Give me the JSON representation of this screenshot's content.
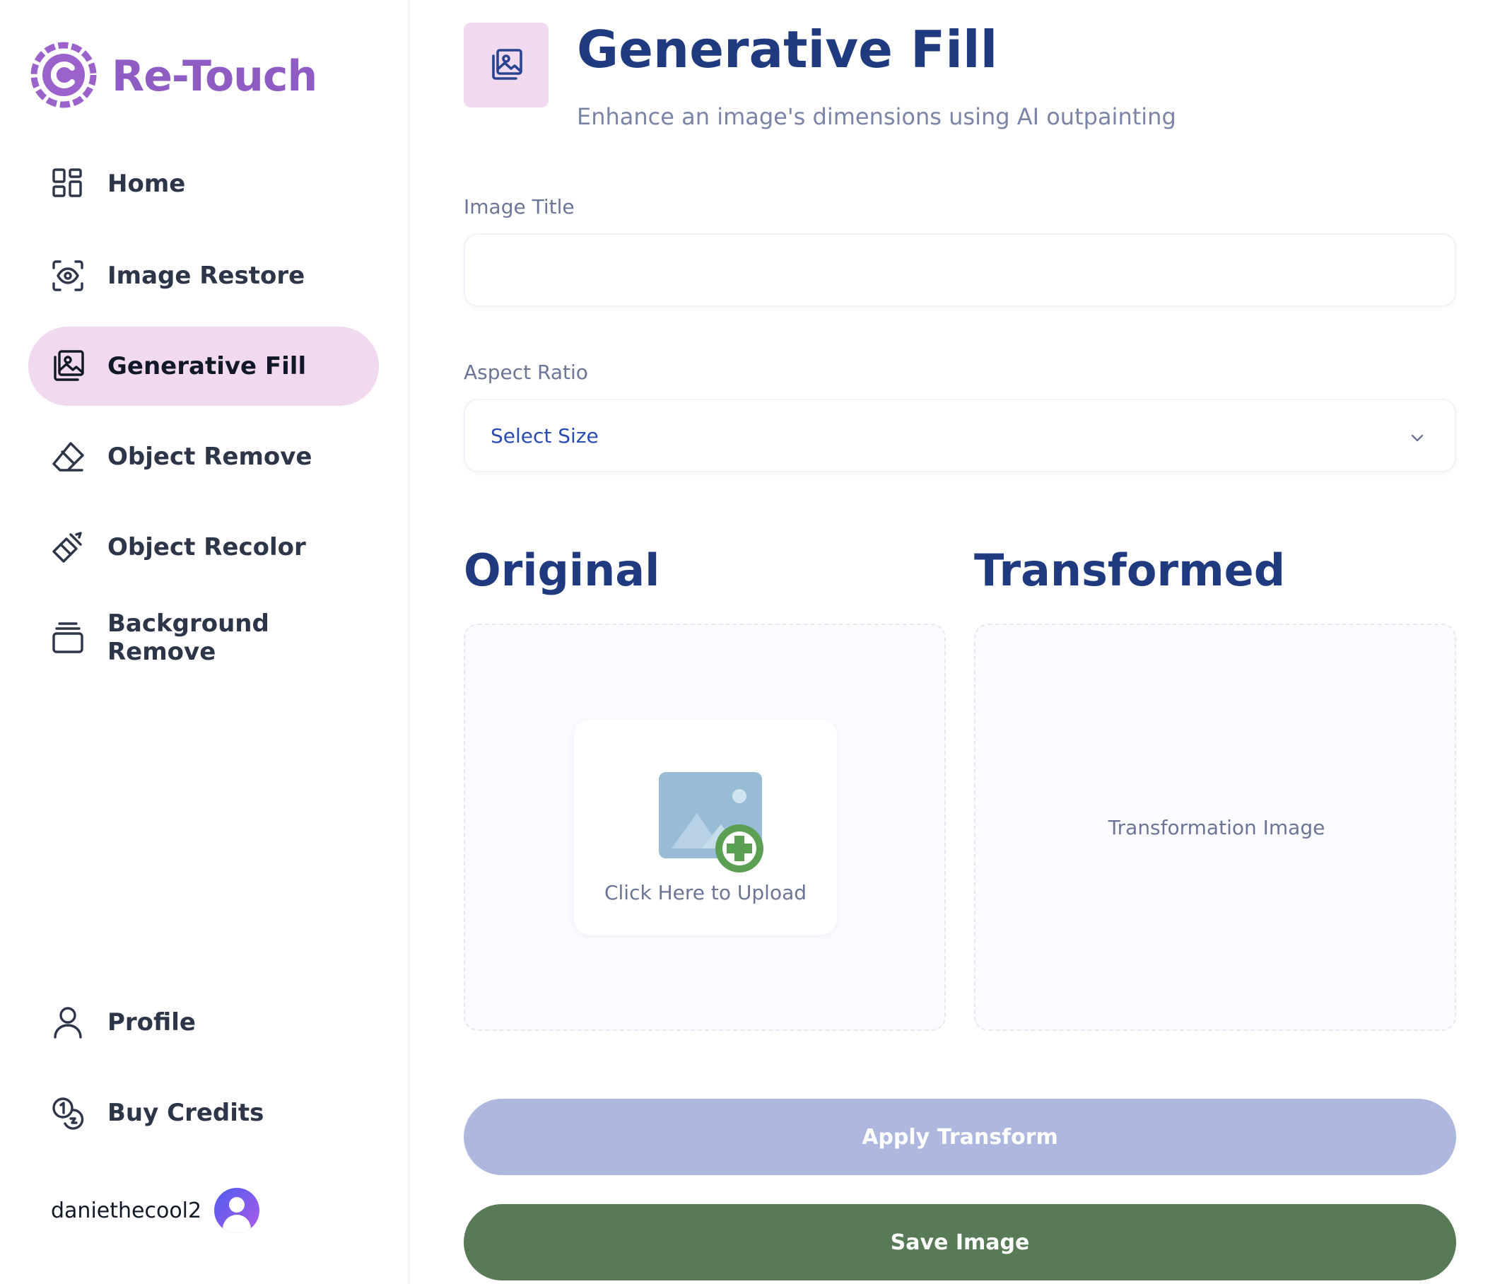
{
  "app": {
    "name": "Re-Touch"
  },
  "sidebar": {
    "items": [
      {
        "label": "Home",
        "icon": "home-grid-icon"
      },
      {
        "label": "Image Restore",
        "icon": "scan-eye-icon"
      },
      {
        "label": "Generative Fill",
        "icon": "images-icon",
        "active": true
      },
      {
        "label": "Object Remove",
        "icon": "eraser-icon"
      },
      {
        "label": "Object Recolor",
        "icon": "paint-brush-icon"
      },
      {
        "label": "Background Remove",
        "icon": "layers-icon"
      }
    ],
    "bottom_items": [
      {
        "label": "Profile",
        "icon": "user-icon"
      },
      {
        "label": "Buy Credits",
        "icon": "coins-icon"
      }
    ],
    "user": {
      "username": "daniethecool2",
      "avatar_icon": "user-avatar-icon"
    }
  },
  "header": {
    "title": "Generative Fill",
    "subtitle": "Enhance an image's dimensions using AI outpainting",
    "icon": "images-icon"
  },
  "form": {
    "image_title": {
      "label": "Image Title",
      "value": ""
    },
    "aspect_ratio": {
      "label": "Aspect Ratio",
      "selected": "Select Size"
    }
  },
  "panels": {
    "original": {
      "heading": "Original",
      "upload_text": "Click Here to Upload",
      "icon": "add-image-icon"
    },
    "transformed": {
      "heading": "Transformed",
      "placeholder": "Transformation Image"
    }
  },
  "actions": {
    "apply_label": "Apply Transform",
    "save_label": "Save Image"
  },
  "colors": {
    "brand": "#8e5cc2",
    "heading": "#1f3a7f",
    "active_bg": "#f1daf0",
    "apply_button": "#aeb7de",
    "save_button": "#587a56"
  }
}
